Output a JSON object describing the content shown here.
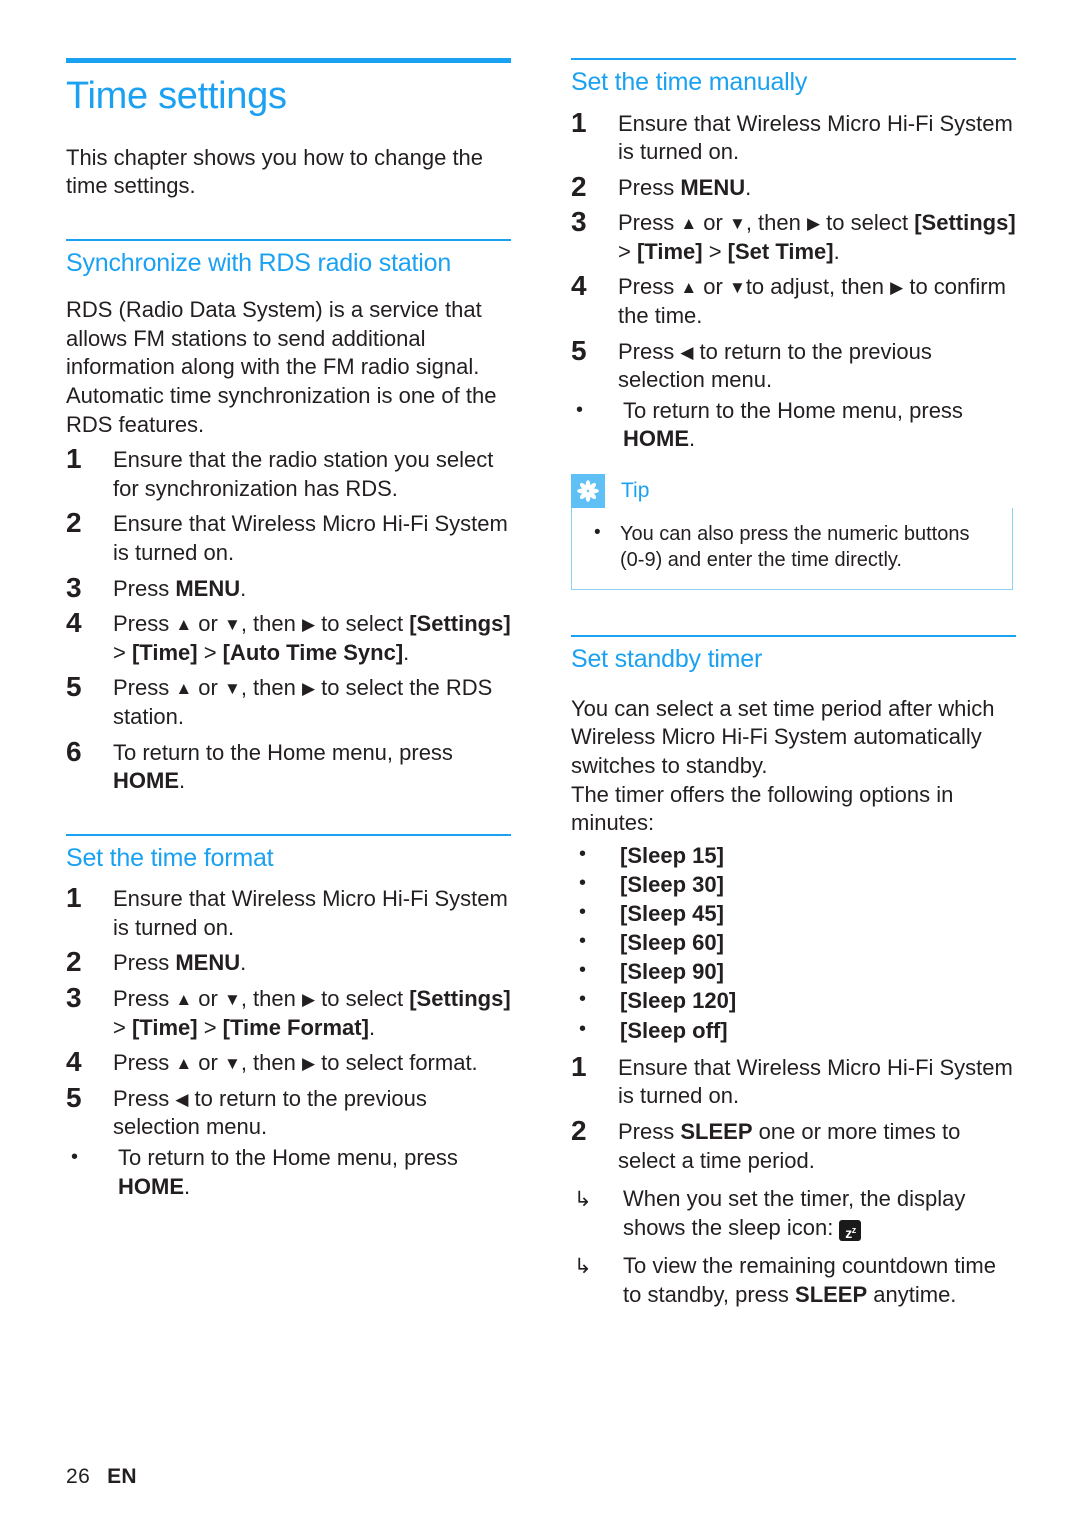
{
  "theme": {
    "accent_blue": "#1ba1f2",
    "tip_badge_blue": "#5fc0f5",
    "tip_border_blue": "#8fd2f8",
    "text_black": "#231f20"
  },
  "footer": {
    "page_number": "26",
    "language": "EN"
  },
  "left_column": {
    "chapter": {
      "title": "Time settings",
      "intro": "This chapter shows you how to change the time settings."
    },
    "sections": [
      {
        "heading": "Synchronize with RDS radio station",
        "intro": "RDS (Radio Data System) is a service that allows FM stations to send additional information along with the FM radio signal. Automatic time synchronization is one of the RDS features.",
        "steps": [
          {
            "num": "1",
            "text": "Ensure that the radio station you select for synchronization has RDS."
          },
          {
            "num": "2",
            "text": "Ensure that Wireless Micro Hi-Fi System is turned on."
          },
          {
            "num": "3",
            "text_before": "Press ",
            "bold1": "MENU",
            "text_after": "."
          },
          {
            "num": "4",
            "text": "Press ▲ or ▼, then ▶ to select [Settings] > [Time] > [Auto Time Sync]."
          },
          {
            "num": "5",
            "text": "Press ▲ or ▼, then ▶ to select the RDS station."
          },
          {
            "num": "6",
            "text_before": "To return to the Home menu, press ",
            "bold1": "HOME",
            "text_after": "."
          }
        ]
      },
      {
        "heading": "Set the time format",
        "steps": [
          {
            "num": "1",
            "text": "Ensure that Wireless Micro Hi-Fi System is turned on."
          },
          {
            "num": "2",
            "text_before": "Press ",
            "bold1": "MENU",
            "text_after": "."
          },
          {
            "num": "3",
            "text": "Press ▲ or ▼, then ▶ to select [Settings] > [Time] > [Time Format]."
          },
          {
            "num": "4",
            "text": "Press ▲ or ▼, then ▶ to select format."
          },
          {
            "num": "5",
            "text": "Press ◀ to return to the previous selection menu."
          }
        ],
        "sub_bullet": {
          "dot": "•",
          "text_before": "To return to the Home menu, press ",
          "bold1": "HOME",
          "text_after": "."
        }
      }
    ]
  },
  "right_column": {
    "sections": [
      {
        "heading": "Set the time manually",
        "steps": [
          {
            "num": "1",
            "text": "Ensure that Wireless Micro Hi-Fi System is turned on."
          },
          {
            "num": "2",
            "text_before": "Press ",
            "bold1": "MENU",
            "text_after": "."
          },
          {
            "num": "3",
            "text": "Press ▲ or ▼, then ▶ to select [Settings] > [Time] > [Set Time]."
          },
          {
            "num": "4",
            "text": "Press ▲ or ▼to adjust, then ▶ to confirm the time."
          },
          {
            "num": "5",
            "text": "Press ◀ to return to the previous selection menu."
          }
        ],
        "sub_bullet": {
          "dot": "•",
          "text_before": "To return to the Home menu, press ",
          "bold1": "HOME",
          "text_after": "."
        }
      },
      {
        "heading": "Set standby timer",
        "intro_1": "You can select a set time period after which Wireless Micro Hi-Fi System automatically switches to standby.",
        "intro_2": "The timer offers the following options in minutes:",
        "options": [
          {
            "dot": "•",
            "label": "[Sleep 15]"
          },
          {
            "dot": "•",
            "label": "[Sleep 30]"
          },
          {
            "dot": "•",
            "label": "[Sleep 45]"
          },
          {
            "dot": "•",
            "label": "[Sleep 60]"
          },
          {
            "dot": "•",
            "label": "[Sleep 90]"
          },
          {
            "dot": "•",
            "label": "[Sleep 120]"
          },
          {
            "dot": "•",
            "label": "[Sleep off]"
          }
        ],
        "steps": [
          {
            "num": "1",
            "text": "Ensure that Wireless Micro Hi-Fi System is turned on."
          },
          {
            "num": "2",
            "text_before": "Press ",
            "bold1": "SLEEP",
            "text_after": " one or more times to select a time period."
          }
        ],
        "results": [
          {
            "arrow": "↳",
            "text_before": "When you set the timer, the display shows the sleep icon: ",
            "icon": "sleep-icon",
            "icon_glyph": "z",
            "icon_sup": "z",
            "text_after": ""
          },
          {
            "arrow": "↳",
            "text_before": "To view the remaining countdown time to standby, press ",
            "bold1": "SLEEP",
            "text_after": " anytime."
          }
        ]
      }
    ]
  },
  "tip": {
    "icon": "asterisk-flower-icon",
    "label": "Tip",
    "bullets": [
      {
        "dot": "•",
        "text": "You can also press the numeric buttons (0-9) and enter the time directly."
      }
    ]
  }
}
